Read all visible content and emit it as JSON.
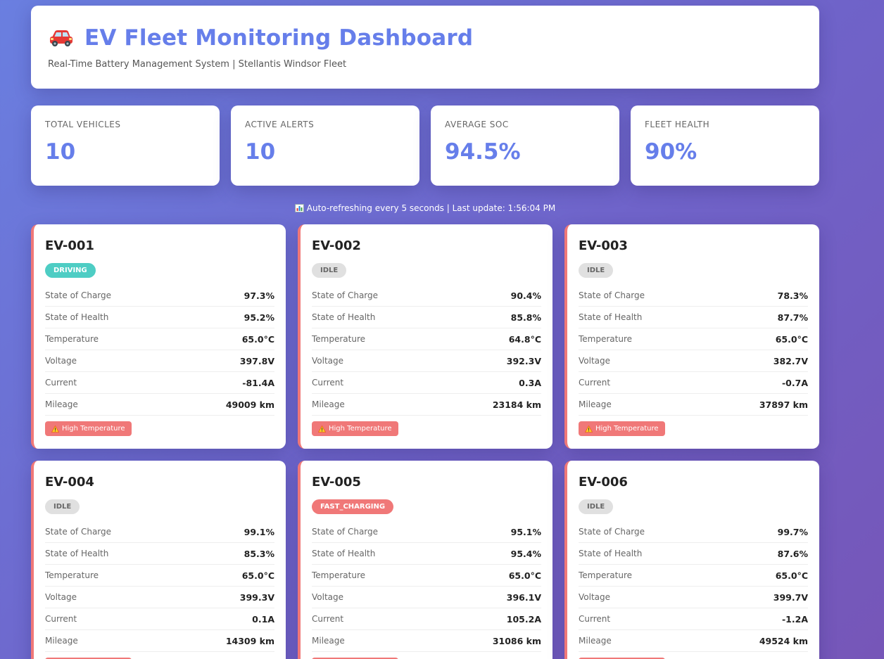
{
  "header": {
    "title": "EV Fleet Monitoring Dashboard",
    "subtitle": "Real-Time Battery Management System | Stellantis Windsor Fleet",
    "icon": "car-icon"
  },
  "stats": [
    {
      "label": "Total Vehicles",
      "value": "10"
    },
    {
      "label": "Active Alerts",
      "value": "10"
    },
    {
      "label": "Average SOC",
      "value": "94.5%"
    },
    {
      "label": "Fleet Health",
      "value": "90%"
    }
  ],
  "refresh": {
    "text": "Auto-refreshing every 5 seconds | Last update: 1:56:04 PM",
    "icon": "chart-icon"
  },
  "row_labels": {
    "soc": "State of Charge",
    "soh": "State of Health",
    "temp": "Temperature",
    "voltage": "Voltage",
    "current": "Current",
    "mileage": "Mileage"
  },
  "colors": {
    "accent": "#667eea",
    "alert": "#f07878",
    "driving": "#4ecdc4",
    "idle": "#e0e0e0"
  },
  "vehicles": [
    {
      "id": "EV-001",
      "status": "DRIVING",
      "soc": "97.3%",
      "soh": "95.2%",
      "temp": "65.0°C",
      "voltage": "397.8V",
      "current": "-81.4A",
      "mileage": "49009 km",
      "alert": "High Temperature"
    },
    {
      "id": "EV-002",
      "status": "IDLE",
      "soc": "90.4%",
      "soh": "85.8%",
      "temp": "64.8°C",
      "voltage": "392.3V",
      "current": "0.3A",
      "mileage": "23184 km",
      "alert": "High Temperature"
    },
    {
      "id": "EV-003",
      "status": "IDLE",
      "soc": "78.3%",
      "soh": "87.7%",
      "temp": "65.0°C",
      "voltage": "382.7V",
      "current": "-0.7A",
      "mileage": "37897 km",
      "alert": "High Temperature"
    },
    {
      "id": "EV-004",
      "status": "IDLE",
      "soc": "99.1%",
      "soh": "85.3%",
      "temp": "65.0°C",
      "voltage": "399.3V",
      "current": "0.1A",
      "mileage": "14309 km",
      "alert": "High Temperature"
    },
    {
      "id": "EV-005",
      "status": "FAST_CHARGING",
      "soc": "95.1%",
      "soh": "95.4%",
      "temp": "65.0°C",
      "voltage": "396.1V",
      "current": "105.2A",
      "mileage": "31086 km",
      "alert": "High Temperature"
    },
    {
      "id": "EV-006",
      "status": "IDLE",
      "soc": "99.7%",
      "soh": "87.6%",
      "temp": "65.0°C",
      "voltage": "399.7V",
      "current": "-1.2A",
      "mileage": "49524 km",
      "alert": "High Temperature"
    }
  ]
}
